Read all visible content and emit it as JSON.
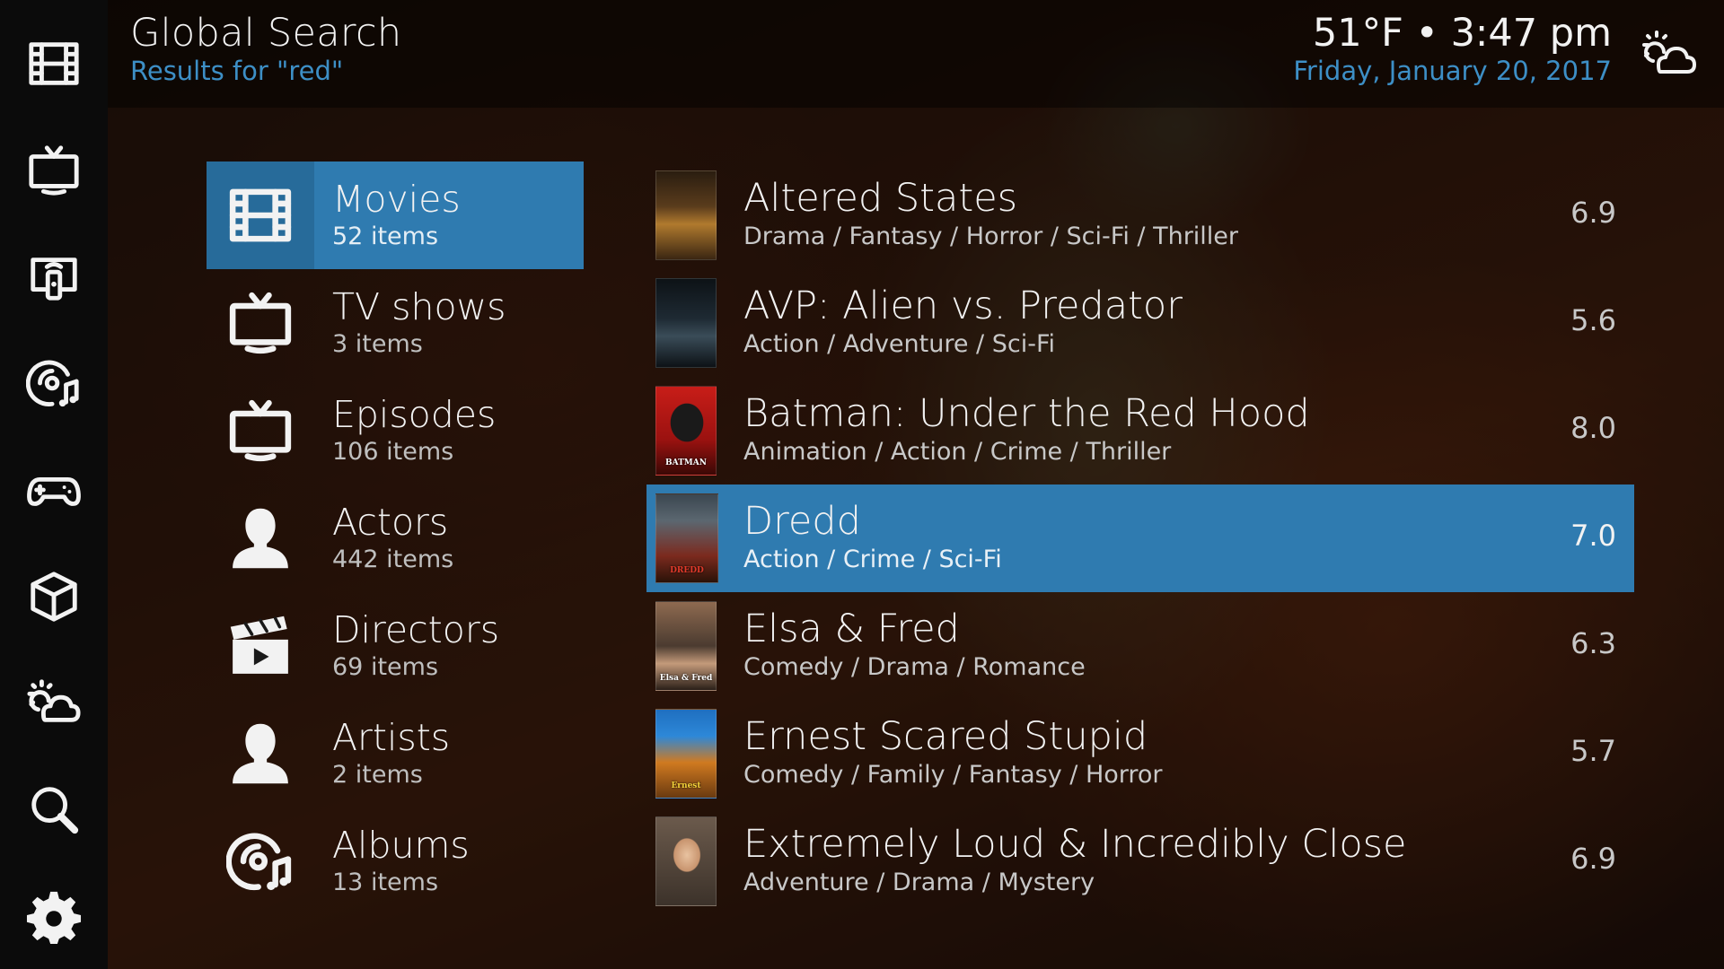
{
  "header": {
    "title": "Global Search",
    "subtitle": "Results for \"red\"",
    "weather": "51°F",
    "separator": "•",
    "time": "3:47 pm",
    "date": "Friday, January 20, 2017"
  },
  "sidebar": {
    "items": [
      {
        "icon": "film-icon"
      },
      {
        "icon": "tv-icon"
      },
      {
        "icon": "remote-tv-icon"
      },
      {
        "icon": "music-disc-icon"
      },
      {
        "icon": "gamepad-icon"
      },
      {
        "icon": "addon-box-icon"
      },
      {
        "icon": "weather-icon"
      },
      {
        "icon": "search-icon"
      },
      {
        "icon": "gear-icon"
      }
    ]
  },
  "categories": [
    {
      "name": "Movies",
      "count": "52 items",
      "icon": "film-icon",
      "selected": true
    },
    {
      "name": "TV shows",
      "count": "3 items",
      "icon": "tv-icon"
    },
    {
      "name": "Episodes",
      "count": "106 items",
      "icon": "tv-icon"
    },
    {
      "name": "Actors",
      "count": "442 items",
      "icon": "person-icon"
    },
    {
      "name": "Directors",
      "count": "69 items",
      "icon": "clapperboard-icon"
    },
    {
      "name": "Artists",
      "count": "2 items",
      "icon": "person-icon"
    },
    {
      "name": "Albums",
      "count": "13 items",
      "icon": "music-disc-icon"
    }
  ],
  "results": [
    {
      "title": "Altered States",
      "genres": "Drama / Fantasy / Horror / Sci-Fi / Thriller",
      "rating": "6.9"
    },
    {
      "title": "AVP: Alien vs. Predator",
      "genres": "Action / Adventure / Sci-Fi",
      "rating": "5.6"
    },
    {
      "title": "Batman: Under the Red Hood",
      "genres": "Animation / Action / Crime / Thriller",
      "rating": "8.0",
      "poster_text": "BATMAN"
    },
    {
      "title": "Dredd",
      "genres": "Action / Crime / Sci-Fi",
      "rating": "7.0",
      "selected": true,
      "poster_text": "DREDD"
    },
    {
      "title": "Elsa & Fred",
      "genres": "Comedy / Drama / Romance",
      "rating": "6.3",
      "poster_text": "Elsa & Fred"
    },
    {
      "title": "Ernest Scared Stupid",
      "genres": "Comedy / Family / Fantasy / Horror",
      "rating": "5.7",
      "poster_text": "Ernest"
    },
    {
      "title": "Extremely Loud & Incredibly Close",
      "genres": "Adventure / Drama / Mystery",
      "rating": "6.9"
    }
  ],
  "colors": {
    "accent": "#2f7bb0",
    "subtitle": "#3d8fc6",
    "sidebar": "#0b0b0b"
  }
}
